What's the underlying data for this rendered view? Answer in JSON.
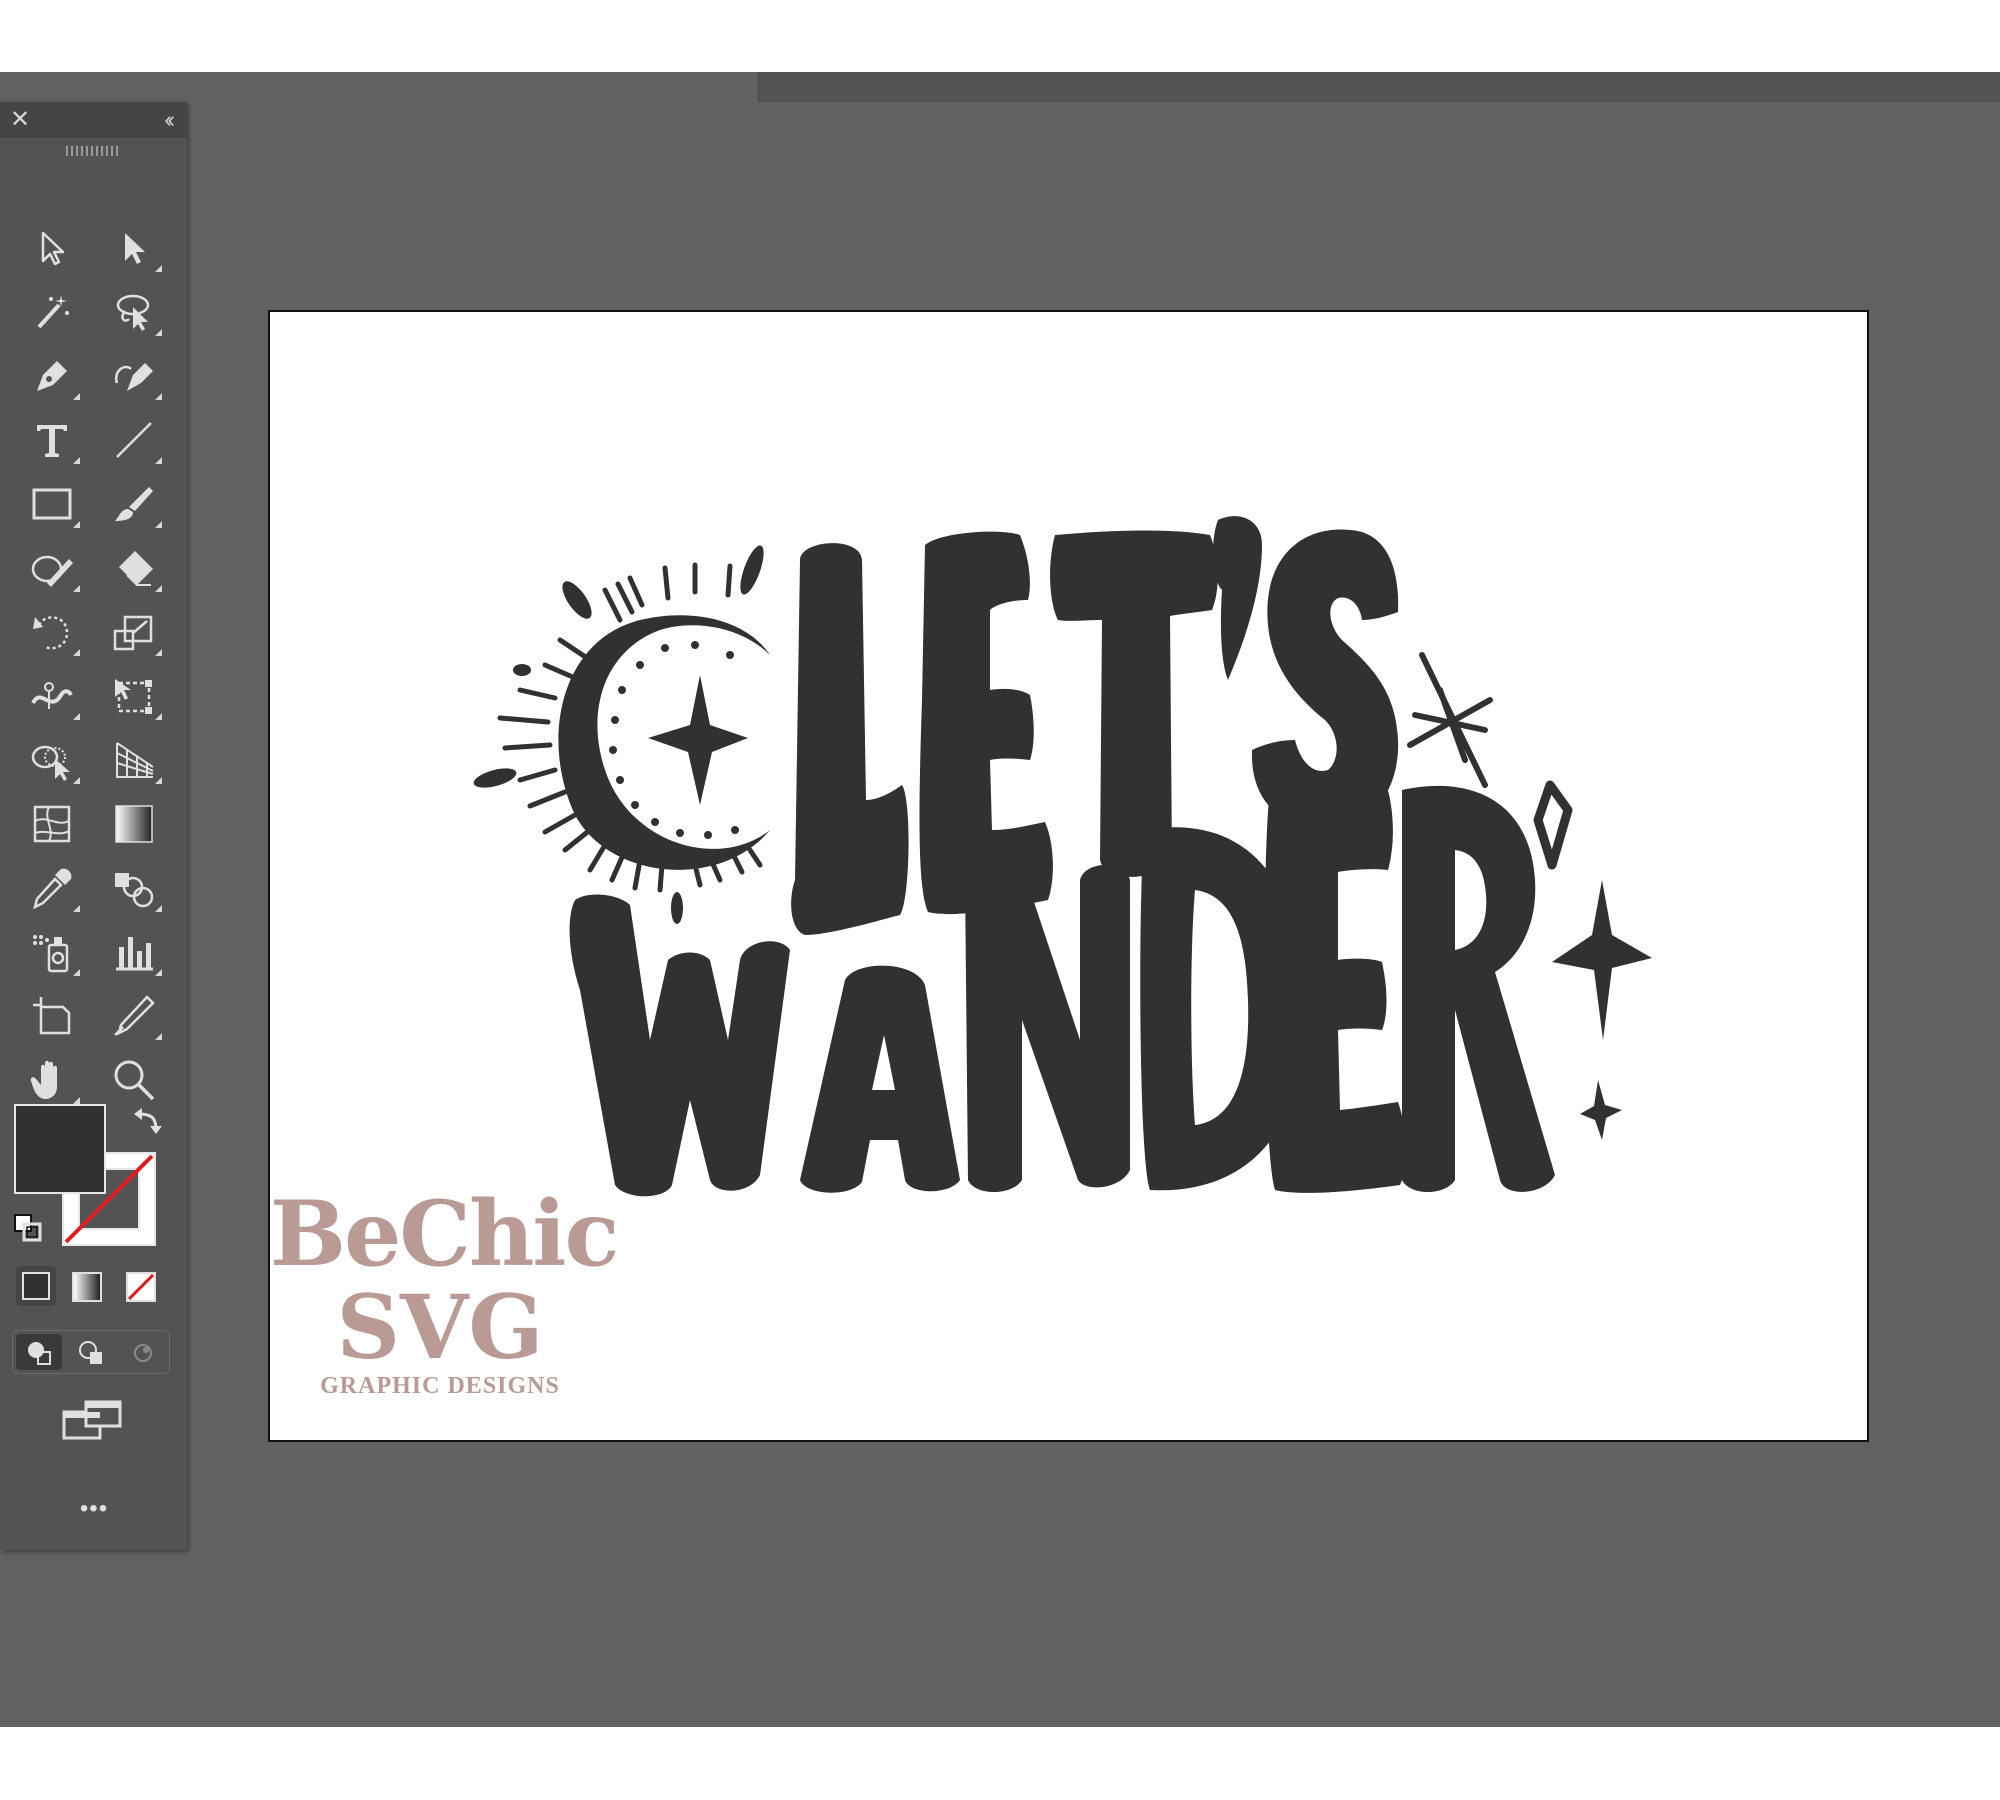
{
  "app": {
    "toolbar": {
      "close_icon_glyph": "✕",
      "collapse_icon_glyph": "‹‹",
      "more_label": "•••",
      "tools": [
        {
          "name": "selection-tool-icon",
          "icon": "arrow-outline"
        },
        {
          "name": "direct-selection-tool-icon",
          "icon": "arrow-filled"
        },
        {
          "name": "magic-wand-tool-icon",
          "icon": "magic-wand"
        },
        {
          "name": "lasso-tool-icon",
          "icon": "lasso"
        },
        {
          "name": "pen-tool-icon",
          "icon": "pen"
        },
        {
          "name": "curvature-tool-icon",
          "icon": "curvature-pen"
        },
        {
          "name": "type-tool-icon",
          "icon": "type-T"
        },
        {
          "name": "line-segment-tool-icon",
          "icon": "line"
        },
        {
          "name": "rectangle-tool-icon",
          "icon": "rectangle"
        },
        {
          "name": "paintbrush-tool-icon",
          "icon": "brush"
        },
        {
          "name": "shaper-tool-icon",
          "icon": "shaper"
        },
        {
          "name": "eraser-tool-icon",
          "icon": "eraser"
        },
        {
          "name": "rotate-tool-icon",
          "icon": "rotate"
        },
        {
          "name": "scale-tool-icon",
          "icon": "scale"
        },
        {
          "name": "width-tool-icon",
          "icon": "width"
        },
        {
          "name": "free-transform-tool-icon",
          "icon": "free-transform"
        },
        {
          "name": "shape-builder-tool-icon",
          "icon": "shape-builder"
        },
        {
          "name": "perspective-grid-tool-icon",
          "icon": "perspective-grid"
        },
        {
          "name": "mesh-tool-icon",
          "icon": "mesh"
        },
        {
          "name": "gradient-tool-icon",
          "icon": "gradient"
        },
        {
          "name": "eyedropper-tool-icon",
          "icon": "eyedropper"
        },
        {
          "name": "blend-tool-icon",
          "icon": "blend"
        },
        {
          "name": "symbol-sprayer-tool-icon",
          "icon": "symbol-sprayer"
        },
        {
          "name": "column-graph-tool-icon",
          "icon": "column-graph"
        },
        {
          "name": "artboard-tool-icon",
          "icon": "artboard"
        },
        {
          "name": "slice-tool-icon",
          "icon": "slice"
        },
        {
          "name": "hand-tool-icon",
          "icon": "hand"
        },
        {
          "name": "zoom-tool-icon",
          "icon": "magnifier"
        }
      ],
      "fill_color": "#333030",
      "stroke_color": "none"
    }
  },
  "canvas": {
    "artboard_color": "#ffffff",
    "workspace_color": "#616161",
    "artwork": {
      "line1": "LET'S",
      "line2": "WANDER",
      "ink_color": "#333030"
    },
    "watermark": {
      "line1": "BeChic",
      "line2": "SVG",
      "line3": "GRAPHIC DESIGNS",
      "color": "#b99a95"
    }
  }
}
